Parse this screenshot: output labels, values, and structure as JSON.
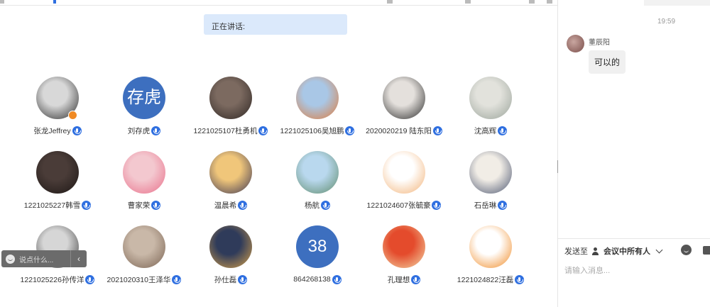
{
  "meeting": {
    "speaking_label": "正在讲话:"
  },
  "participants": [
    {
      "name": "张龙Jeffrey",
      "host": true,
      "avatar_text": "",
      "colors": [
        "#d8d8d8",
        "#2b2b2b"
      ]
    },
    {
      "name": "刘存虎",
      "host": false,
      "avatar_text": "存虎",
      "colors": [
        "#3d6fbf",
        "#3d6fbf"
      ]
    },
    {
      "name": "1221025107杜勇机",
      "host": false,
      "avatar_text": "",
      "colors": [
        "#7c6a60",
        "#2e2623"
      ]
    },
    {
      "name": "1221025106吴旭鹏",
      "host": false,
      "avatar_text": "",
      "colors": [
        "#a9c7e6",
        "#e07b3a"
      ]
    },
    {
      "name": "2020020219 陆东阳",
      "host": false,
      "avatar_text": "",
      "colors": [
        "#e4e0dc",
        "#2a2a2a"
      ]
    },
    {
      "name": "沈高辉",
      "host": false,
      "avatar_text": "",
      "colors": [
        "#e2e2dc",
        "#9aa39a"
      ]
    },
    {
      "name": "1221025227韩雪",
      "host": false,
      "avatar_text": "",
      "colors": [
        "#4a3c38",
        "#1d1715"
      ]
    },
    {
      "name": "曹家荣",
      "host": false,
      "avatar_text": "",
      "colors": [
        "#f3c8cf",
        "#e96f8a"
      ]
    },
    {
      "name": "温晨希",
      "host": false,
      "avatar_text": "",
      "colors": [
        "#f0c67a",
        "#3b3553"
      ]
    },
    {
      "name": "杨航",
      "host": false,
      "avatar_text": "",
      "colors": [
        "#b9d8ee",
        "#5d8a6a"
      ]
    },
    {
      "name": "1221024607张毓豪",
      "host": false,
      "avatar_text": "",
      "colors": [
        "#ffffff",
        "#f2b277"
      ]
    },
    {
      "name": "石岳琳",
      "host": false,
      "avatar_text": "",
      "colors": [
        "#f1ede6",
        "#4b5570"
      ]
    },
    {
      "name": "1221025226孙传洋",
      "host": false,
      "avatar_text": "",
      "colors": [
        "#d6d6d6",
        "#3a3a3a"
      ]
    },
    {
      "name": "2021020310王泽华",
      "host": false,
      "avatar_text": "",
      "colors": [
        "#c9b8a8",
        "#7a6352"
      ]
    },
    {
      "name": "孙仕磊",
      "host": false,
      "avatar_text": "",
      "colors": [
        "#2f3b5a",
        "#d8a24a"
      ]
    },
    {
      "name": "864268138",
      "host": false,
      "avatar_text": "38",
      "colors": [
        "#3d6fbf",
        "#3d6fbf"
      ]
    },
    {
      "name": "孔理想",
      "host": false,
      "avatar_text": "",
      "colors": [
        "#e44b2c",
        "#f3d9a8"
      ]
    },
    {
      "name": "1221024822汪磊",
      "host": false,
      "avatar_text": "",
      "colors": [
        "#ffffff",
        "#f08a24"
      ]
    }
  ],
  "quick_input": {
    "placeholder": "说点什么...",
    "collapse_icon": "chevron-left-icon"
  },
  "chat": {
    "time": "19:59",
    "sender": "董辰阳",
    "message": "可以的",
    "send_to_label": "发送至",
    "recipient": "会议中所有人",
    "input_placeholder": "请输入消息..."
  },
  "colors": {
    "accent": "#2f6fe0",
    "speaking_bg": "#dbe9fb",
    "avatar_blue": "#3d6fbf",
    "host_badge": "#f08a24"
  }
}
